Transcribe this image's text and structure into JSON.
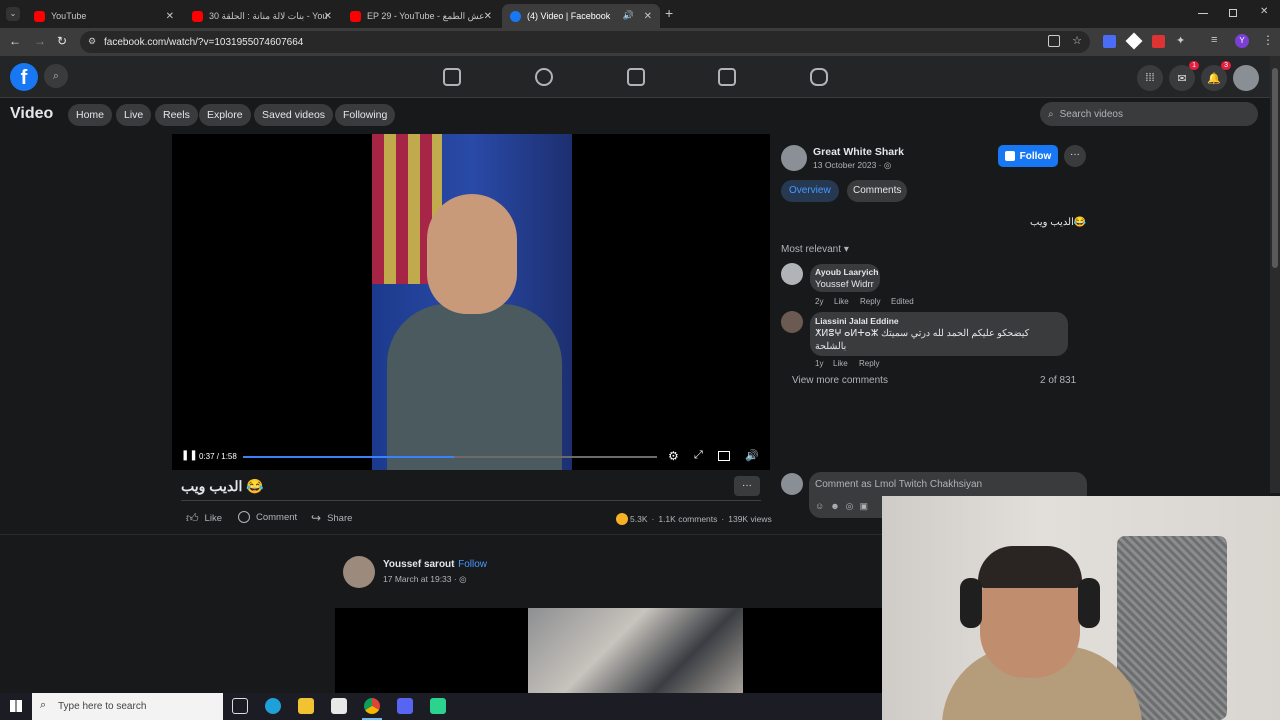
{
  "browser": {
    "tabs": [
      {
        "title": "YouTube",
        "favicon_color": "#ff0000"
      },
      {
        "title": "بنات لالة منانة : الحلقة 30 - YouTube",
        "favicon_color": "#ff0000"
      },
      {
        "title": "EP 29 - YouTube - عش الطمع",
        "favicon_color": "#ff0000"
      },
      {
        "title": "(4) Video | Facebook",
        "favicon_color": "#1877f2"
      }
    ],
    "new_tab": "+",
    "url": "facebook.com/watch/?v=1031955074607664"
  },
  "fb": {
    "logo": "f",
    "nav_icons": [
      "home-icon",
      "friends-icon",
      "watch-icon",
      "marketplace-icon",
      "gaming-icon"
    ],
    "messenger_badge": "1",
    "notifications_badge": "3",
    "page_title": "Video",
    "tabs": [
      "Home",
      "Live",
      "Reels",
      "Explore",
      "Saved videos",
      "Following"
    ],
    "search_placeholder": "Search videos"
  },
  "video": {
    "time": "0:37 / 1:58",
    "progress": 0.51,
    "title": "الديب ويب 😂",
    "more": "···",
    "actions": {
      "like": "Like",
      "comment": "Comment",
      "share": "Share"
    },
    "stats": {
      "reactions": "5.3K",
      "comments": "1.1K comments",
      "views": "139K views"
    }
  },
  "sidebar": {
    "author": "Great White Shark",
    "date": "13 October 2023 · ",
    "follow": "Follow",
    "tabs": [
      "Overview",
      "Comments"
    ],
    "caption": "الديب ويب😂",
    "sort": "Most relevant",
    "comments": [
      {
        "name": "Ayoub Laaryich",
        "text": "Youssef Widrr",
        "time": "2y",
        "like": "Like",
        "reply": "Reply",
        "edited": "Edited"
      },
      {
        "name": "Liassini Jalal Eddine",
        "text": "ⵅⵍⵓⵖ ⴰⵍⵜⴰⵣ كيضحكو عليكم الحمد لله درتي سميتك",
        "text2": "بالشلحة",
        "time": "1y",
        "like": "Like",
        "reply": "Reply"
      }
    ],
    "view_more": "View more comments",
    "count": "2 of 831",
    "comment_as": "Comment as Lmol Twitch Chakhsiyan"
  },
  "next_post": {
    "author": "Youssef sarout",
    "follow": "· Follow",
    "date": "17 March at 19:33 · "
  },
  "taskbar": {
    "search": "Type here to search"
  }
}
